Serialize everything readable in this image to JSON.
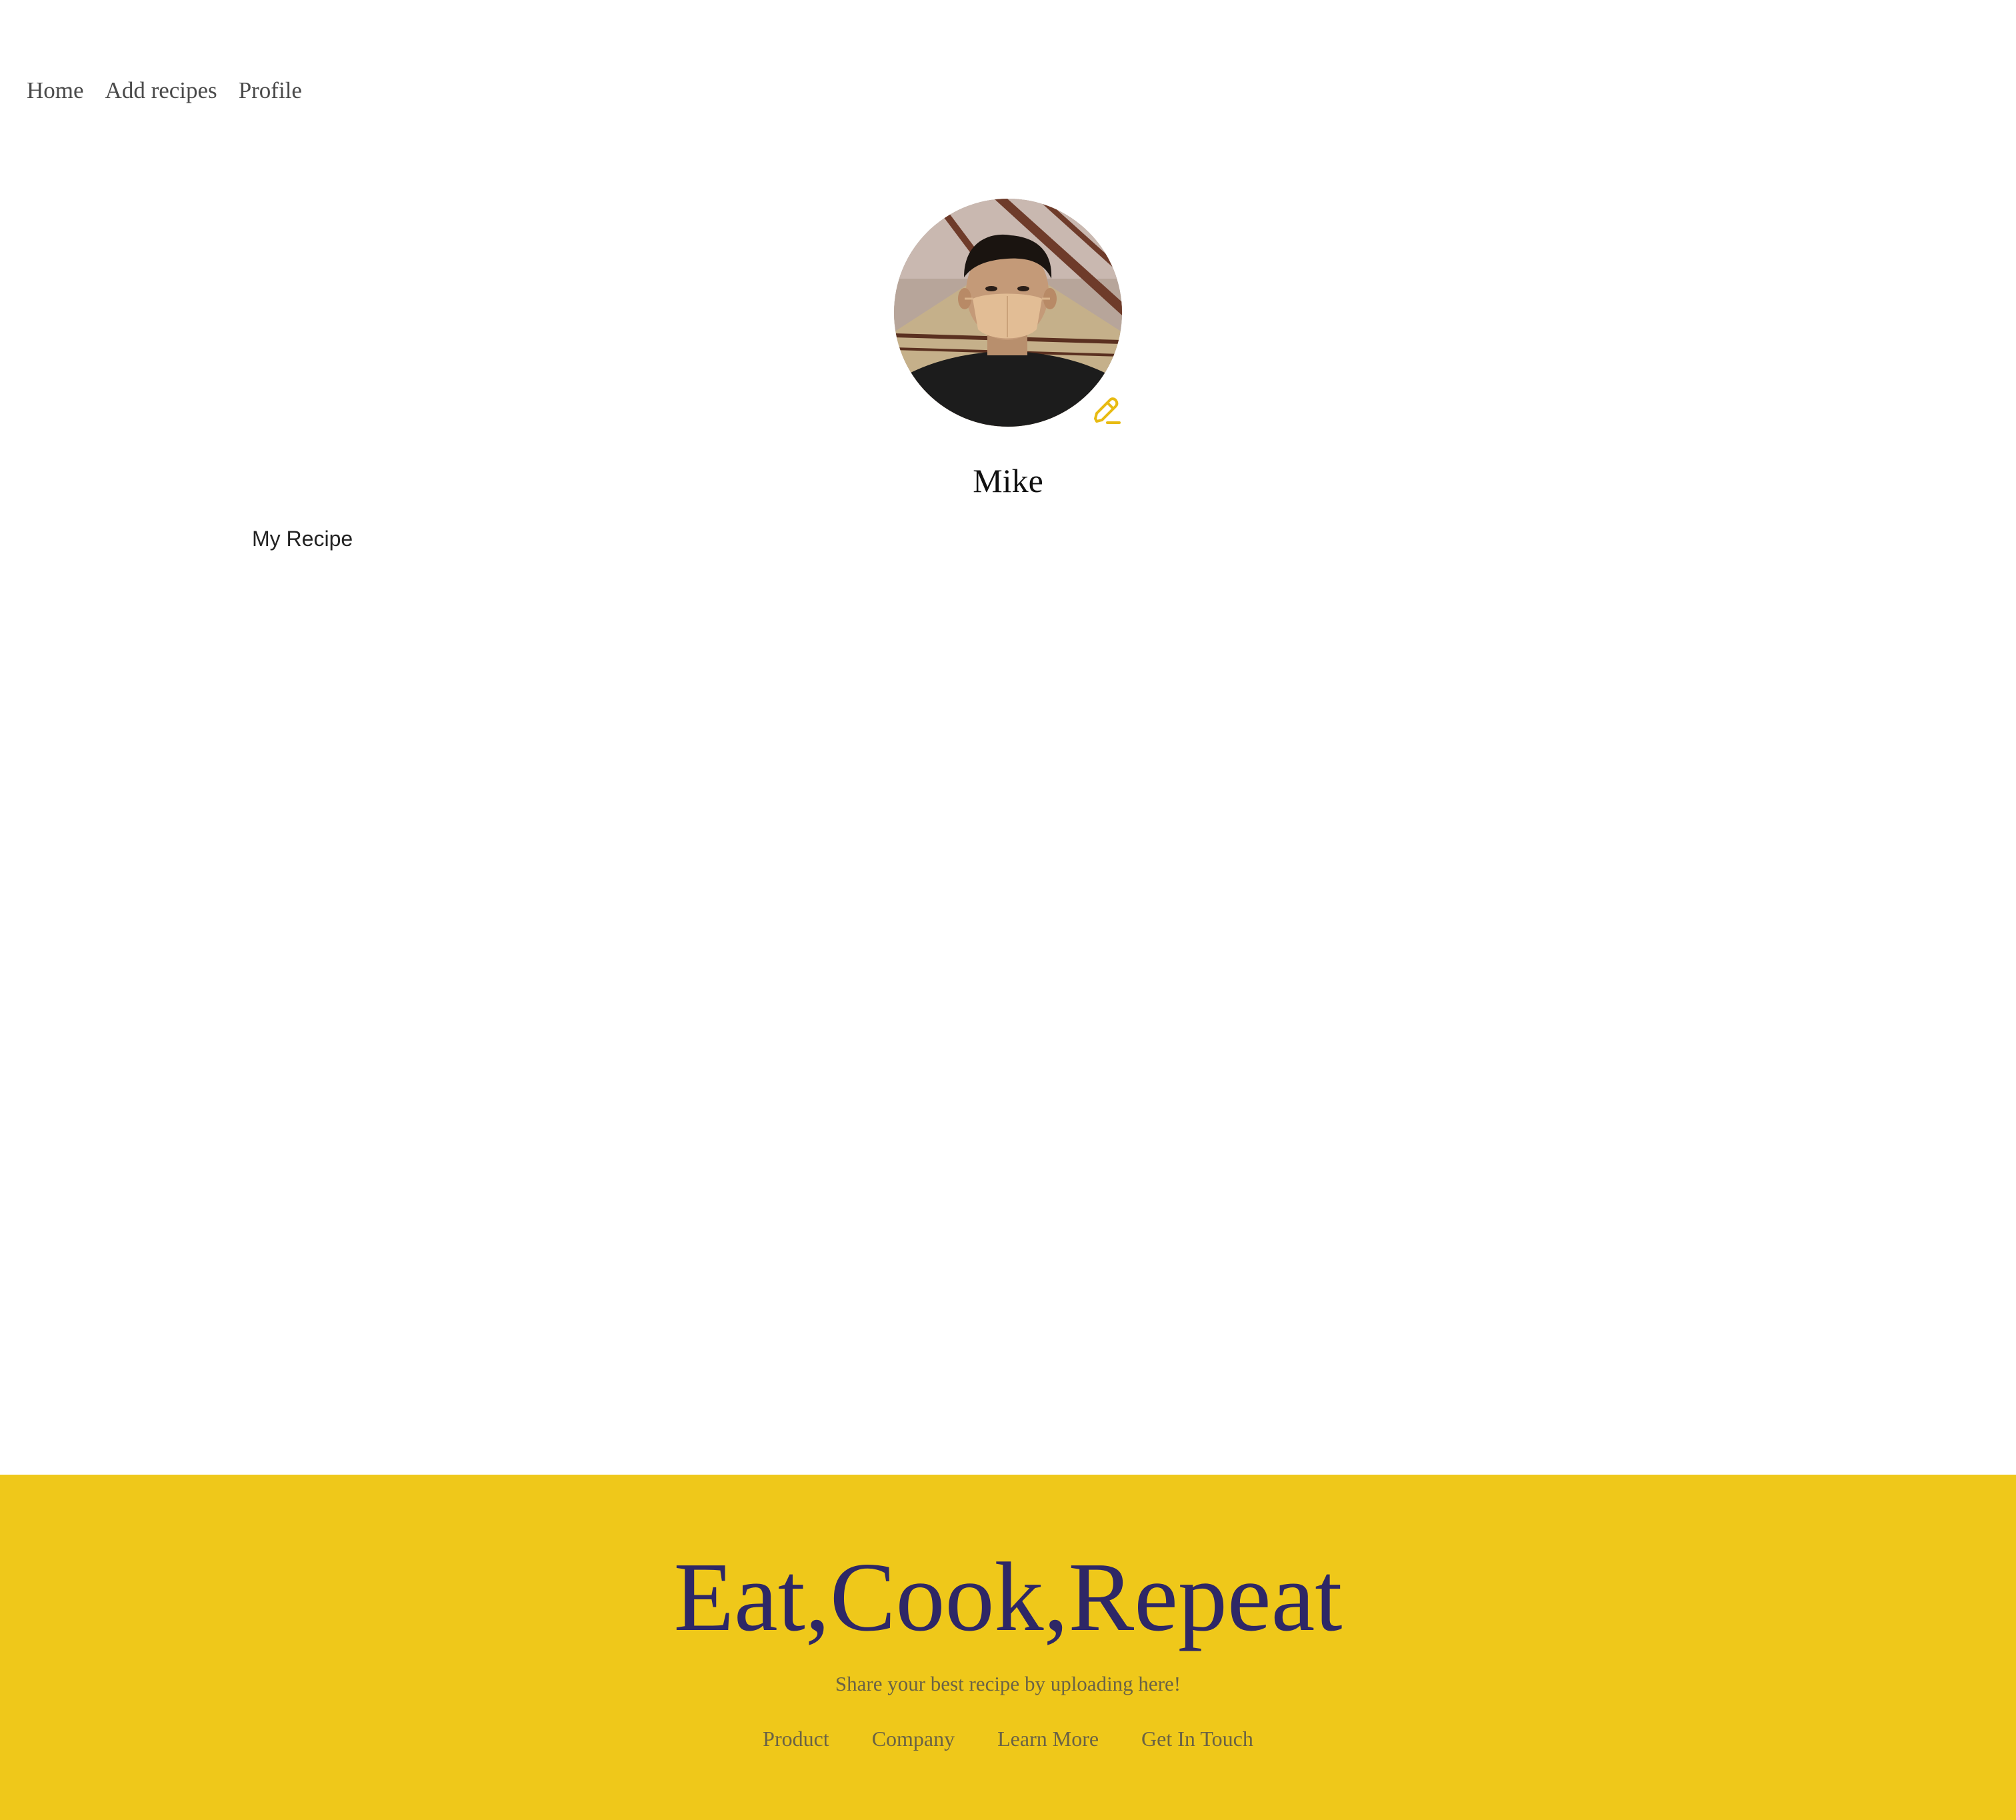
{
  "nav": {
    "items": [
      {
        "label": "Home"
      },
      {
        "label": "Add recipes"
      },
      {
        "label": "Profile"
      }
    ]
  },
  "profile": {
    "name": "Mike",
    "avatar_icon": "user-photo",
    "edit_icon": "pencil-icon"
  },
  "main": {
    "section_title": "My Recipe"
  },
  "footer": {
    "title": "Eat,Cook,Repeat",
    "subtitle": "Share your best recipe by uploading here!",
    "links": [
      {
        "label": "Product"
      },
      {
        "label": "Company"
      },
      {
        "label": "Learn More"
      },
      {
        "label": "Get In Touch"
      }
    ]
  },
  "colors": {
    "accent": "#efc81a",
    "footer_title": "#2e2766",
    "nav_text": "#4a4a4a",
    "background": "#ffffff"
  }
}
